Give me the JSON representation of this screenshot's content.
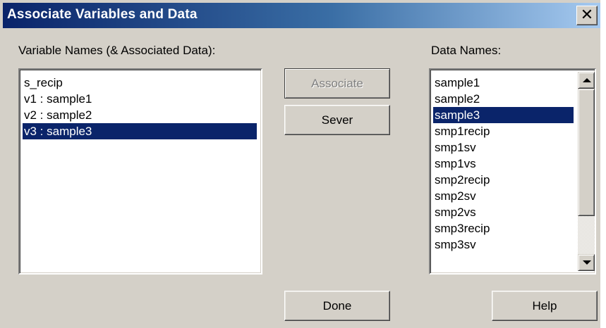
{
  "window": {
    "title": "Associate Variables and Data",
    "close_glyph": "✕"
  },
  "labels": {
    "variable_names": "Variable Names (& Associated Data):",
    "data_names": "Data Names:"
  },
  "variable_list": {
    "items": [
      "s_recip",
      "v1 : sample1",
      "v2 : sample2",
      "v3 : sample3"
    ],
    "selected_index": 3
  },
  "data_list": {
    "items": [
      "sample1",
      "sample2",
      "sample3",
      "smp1recip",
      "smp1sv",
      "smp1vs",
      "smp2recip",
      "smp2sv",
      "smp2vs",
      "smp3recip",
      "smp3sv"
    ],
    "selected_index": 2,
    "scroll_position": 0
  },
  "buttons": {
    "associate": "Associate",
    "sever": "Sever",
    "done": "Done",
    "help": "Help"
  },
  "icons": {
    "close": "close-icon",
    "scroll_up": "arrow-up-icon",
    "scroll_down": "arrow-down-icon"
  },
  "colors": {
    "title_bar_start": "#0a246a",
    "title_bar_end": "#a6caf0",
    "selection": "#0a246a",
    "dialog_face": "#d4d0c8"
  }
}
